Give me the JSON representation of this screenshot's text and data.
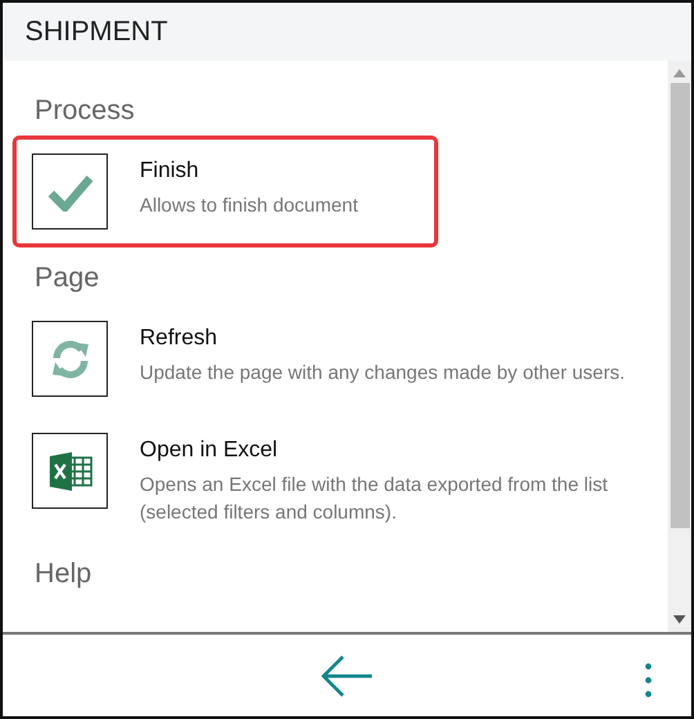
{
  "header": {
    "title": "SHIPMENT"
  },
  "groups": [
    {
      "title": "Process",
      "actions": [
        {
          "kind": "check",
          "title": "Finish",
          "description": "Allows to finish document",
          "selected": true
        }
      ]
    },
    {
      "title": "Page",
      "actions": [
        {
          "kind": "refresh",
          "title": "Refresh",
          "description": "Update the page with any changes made by other users.",
          "selected": false
        },
        {
          "kind": "excel",
          "title": "Open in Excel",
          "description": "Opens an Excel file with the data exported from the list (selected filters and columns).",
          "selected": false
        }
      ]
    },
    {
      "title": "Help"
    }
  ]
}
